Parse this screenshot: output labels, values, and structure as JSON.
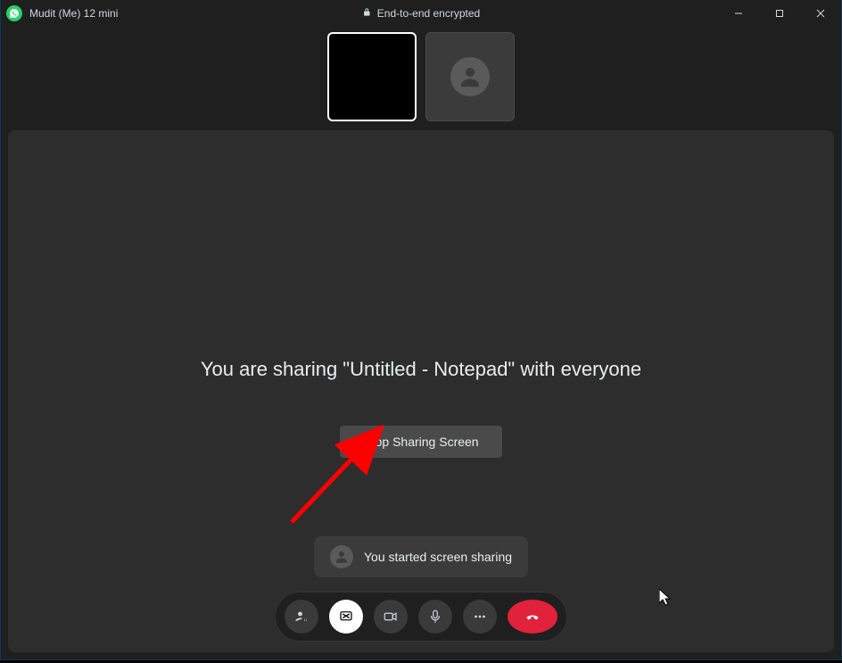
{
  "titlebar": {
    "caller_name": "Mudit (Me) 12 mini",
    "encryption_label": "End-to-end encrypted"
  },
  "main": {
    "sharing_message": "You are sharing \"Untitled - Notepad\" with everyone",
    "stop_button_label": "Stop Sharing Screen",
    "status_text": "You started screen sharing"
  },
  "controls": {
    "add_participant": "add-participant",
    "screen_share": "screen-share",
    "video": "video",
    "mic": "microphone",
    "more": "more-options",
    "end": "end-call"
  },
  "colors": {
    "accent_green": "#25d366",
    "end_red": "#e2213b",
    "panel": "#2d2d2d",
    "window": "#1f1f1f"
  }
}
